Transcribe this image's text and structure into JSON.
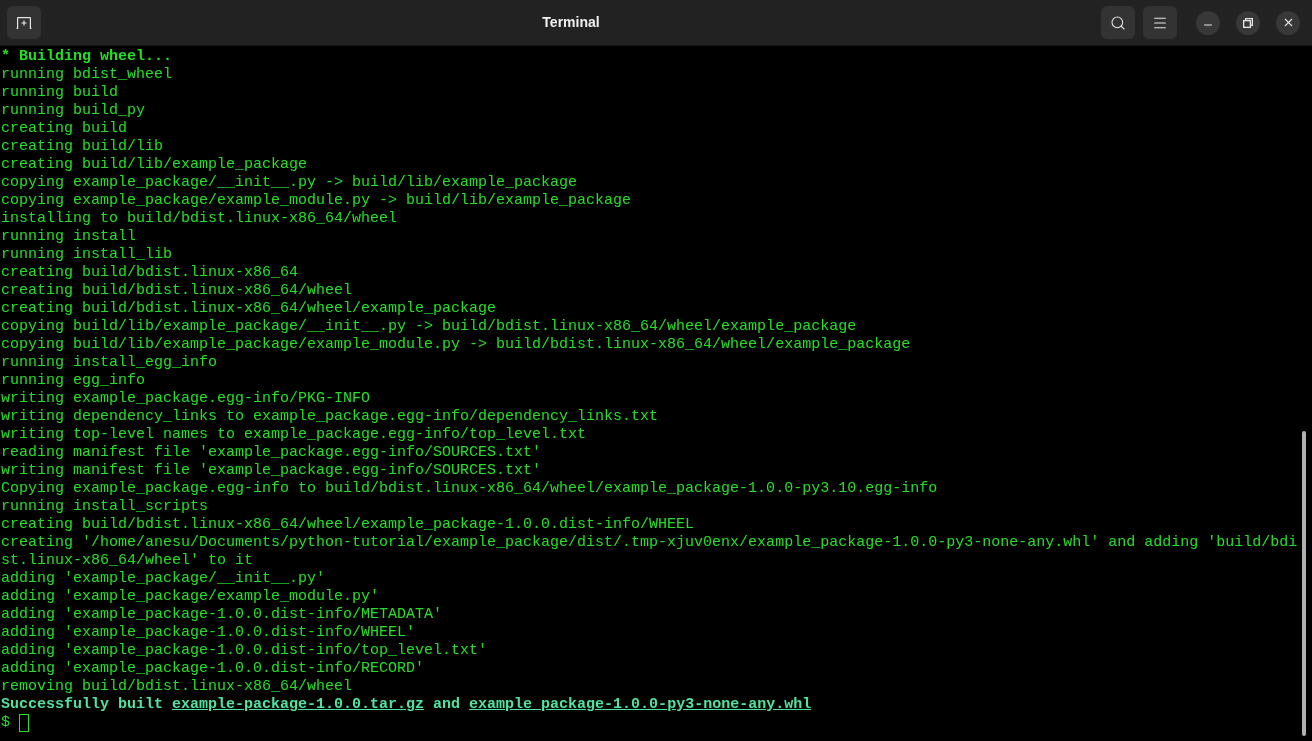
{
  "window": {
    "title": "Terminal"
  },
  "terminal": {
    "lines": [
      {
        "kind": "bold",
        "text": "* Building wheel..."
      },
      {
        "kind": "plain",
        "text": "running bdist_wheel"
      },
      {
        "kind": "plain",
        "text": "running build"
      },
      {
        "kind": "plain",
        "text": "running build_py"
      },
      {
        "kind": "plain",
        "text": "creating build"
      },
      {
        "kind": "plain",
        "text": "creating build/lib"
      },
      {
        "kind": "plain",
        "text": "creating build/lib/example_package"
      },
      {
        "kind": "plain",
        "text": "copying example_package/__init__.py -> build/lib/example_package"
      },
      {
        "kind": "plain",
        "text": "copying example_package/example_module.py -> build/lib/example_package"
      },
      {
        "kind": "plain",
        "text": "installing to build/bdist.linux-x86_64/wheel"
      },
      {
        "kind": "plain",
        "text": "running install"
      },
      {
        "kind": "plain",
        "text": "running install_lib"
      },
      {
        "kind": "plain",
        "text": "creating build/bdist.linux-x86_64"
      },
      {
        "kind": "plain",
        "text": "creating build/bdist.linux-x86_64/wheel"
      },
      {
        "kind": "plain",
        "text": "creating build/bdist.linux-x86_64/wheel/example_package"
      },
      {
        "kind": "plain",
        "text": "copying build/lib/example_package/__init__.py -> build/bdist.linux-x86_64/wheel/example_package"
      },
      {
        "kind": "plain",
        "text": "copying build/lib/example_package/example_module.py -> build/bdist.linux-x86_64/wheel/example_package"
      },
      {
        "kind": "plain",
        "text": "running install_egg_info"
      },
      {
        "kind": "plain",
        "text": "running egg_info"
      },
      {
        "kind": "plain",
        "text": "writing example_package.egg-info/PKG-INFO"
      },
      {
        "kind": "plain",
        "text": "writing dependency_links to example_package.egg-info/dependency_links.txt"
      },
      {
        "kind": "plain",
        "text": "writing top-level names to example_package.egg-info/top_level.txt"
      },
      {
        "kind": "plain",
        "text": "reading manifest file 'example_package.egg-info/SOURCES.txt'"
      },
      {
        "kind": "plain",
        "text": "writing manifest file 'example_package.egg-info/SOURCES.txt'"
      },
      {
        "kind": "plain",
        "text": "Copying example_package.egg-info to build/bdist.linux-x86_64/wheel/example_package-1.0.0-py3.10.egg-info"
      },
      {
        "kind": "plain",
        "text": "running install_scripts"
      },
      {
        "kind": "plain",
        "text": "creating build/bdist.linux-x86_64/wheel/example_package-1.0.0.dist-info/WHEEL"
      },
      {
        "kind": "plain",
        "text": "creating '/home/anesu/Documents/python-tutorial/example_package/dist/.tmp-xjuv0enx/example_package-1.0.0-py3-none-any.whl' and adding 'build/bdi"
      },
      {
        "kind": "plain",
        "text": "st.linux-x86_64/wheel' to it"
      },
      {
        "kind": "plain",
        "text": "adding 'example_package/__init__.py'"
      },
      {
        "kind": "plain",
        "text": "adding 'example_package/example_module.py'"
      },
      {
        "kind": "plain",
        "text": "adding 'example_package-1.0.0.dist-info/METADATA'"
      },
      {
        "kind": "plain",
        "text": "adding 'example_package-1.0.0.dist-info/WHEEL'"
      },
      {
        "kind": "plain",
        "text": "adding 'example_package-1.0.0.dist-info/top_level.txt'"
      },
      {
        "kind": "plain",
        "text": "adding 'example_package-1.0.0.dist-info/RECORD'"
      },
      {
        "kind": "plain",
        "text": "removing build/bdist.linux-x86_64/wheel"
      },
      {
        "kind": "result",
        "segments": [
          {
            "text": "Successfully built ",
            "link": false
          },
          {
            "text": "example-package-1.0.0.tar.gz",
            "link": true
          },
          {
            "text": " and ",
            "link": false
          },
          {
            "text": "example_package-1.0.0-py3-none-any.whl",
            "link": true
          }
        ]
      }
    ],
    "prompt": {
      "symbol": "$"
    }
  }
}
